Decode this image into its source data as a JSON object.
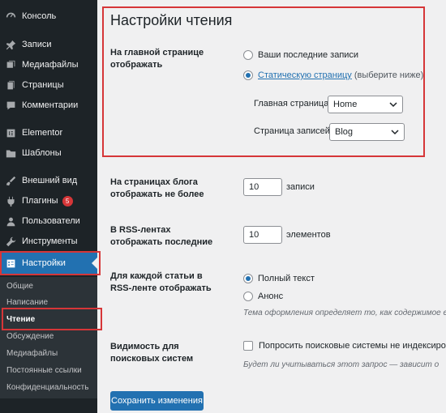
{
  "sidebar": {
    "items": [
      {
        "label": "Консоль",
        "icon": "dashboard-icon"
      },
      {
        "label": "Записи",
        "icon": "pin-icon"
      },
      {
        "label": "Медиафайлы",
        "icon": "media-icon"
      },
      {
        "label": "Страницы",
        "icon": "pages-icon"
      },
      {
        "label": "Комментарии",
        "icon": "comments-icon"
      },
      {
        "label": "Elementor",
        "icon": "elementor-icon"
      },
      {
        "label": "Шаблоны",
        "icon": "folder-icon"
      },
      {
        "label": "Внешний вид",
        "icon": "brush-icon"
      },
      {
        "label": "Плагины",
        "icon": "plugin-icon",
        "badge": "5"
      },
      {
        "label": "Пользователи",
        "icon": "users-icon"
      },
      {
        "label": "Инструменты",
        "icon": "wrench-icon"
      },
      {
        "label": "Настройки",
        "icon": "settings-icon"
      }
    ],
    "submenu": [
      "Общие",
      "Написание",
      "Чтение",
      "Обсуждение",
      "Медиафайлы",
      "Постоянные ссылки",
      "Конфиденциальность"
    ]
  },
  "main": {
    "title": "Настройки чтения",
    "front_page": {
      "label": "На главной странице отображать",
      "opt_latest": "Ваши последние записи",
      "opt_static_link": "Статическую страницу",
      "opt_static_suffix": "(выберите ниже)",
      "home_label": "Главная страница:",
      "home_value": "Home",
      "posts_label": "Страница записей:",
      "posts_value": "Blog"
    },
    "blog_pages": {
      "label": "На страницах блога отображать не более",
      "value": "10",
      "suffix": "записи"
    },
    "rss": {
      "label": "В RSS-лентах отображать последние",
      "value": "10",
      "suffix": "элементов"
    },
    "feed_content": {
      "label": "Для каждой статьи в RSS-ленте отображать",
      "opt_full": "Полный текст",
      "opt_summary": "Анонс",
      "desc": "Тема оформления определяет то, как содержимое е"
    },
    "search_visibility": {
      "label": "Видимость для поисковых систем",
      "checkbox_label": "Попросить поисковые системы не индексировать",
      "desc": "Будет ли учитываться этот запрос — зависит о"
    },
    "save_label": "Сохранить изменения"
  },
  "colors": {
    "accent": "#2271b1",
    "sidebar_bg": "#1d2327",
    "highlight": "#d63638"
  }
}
